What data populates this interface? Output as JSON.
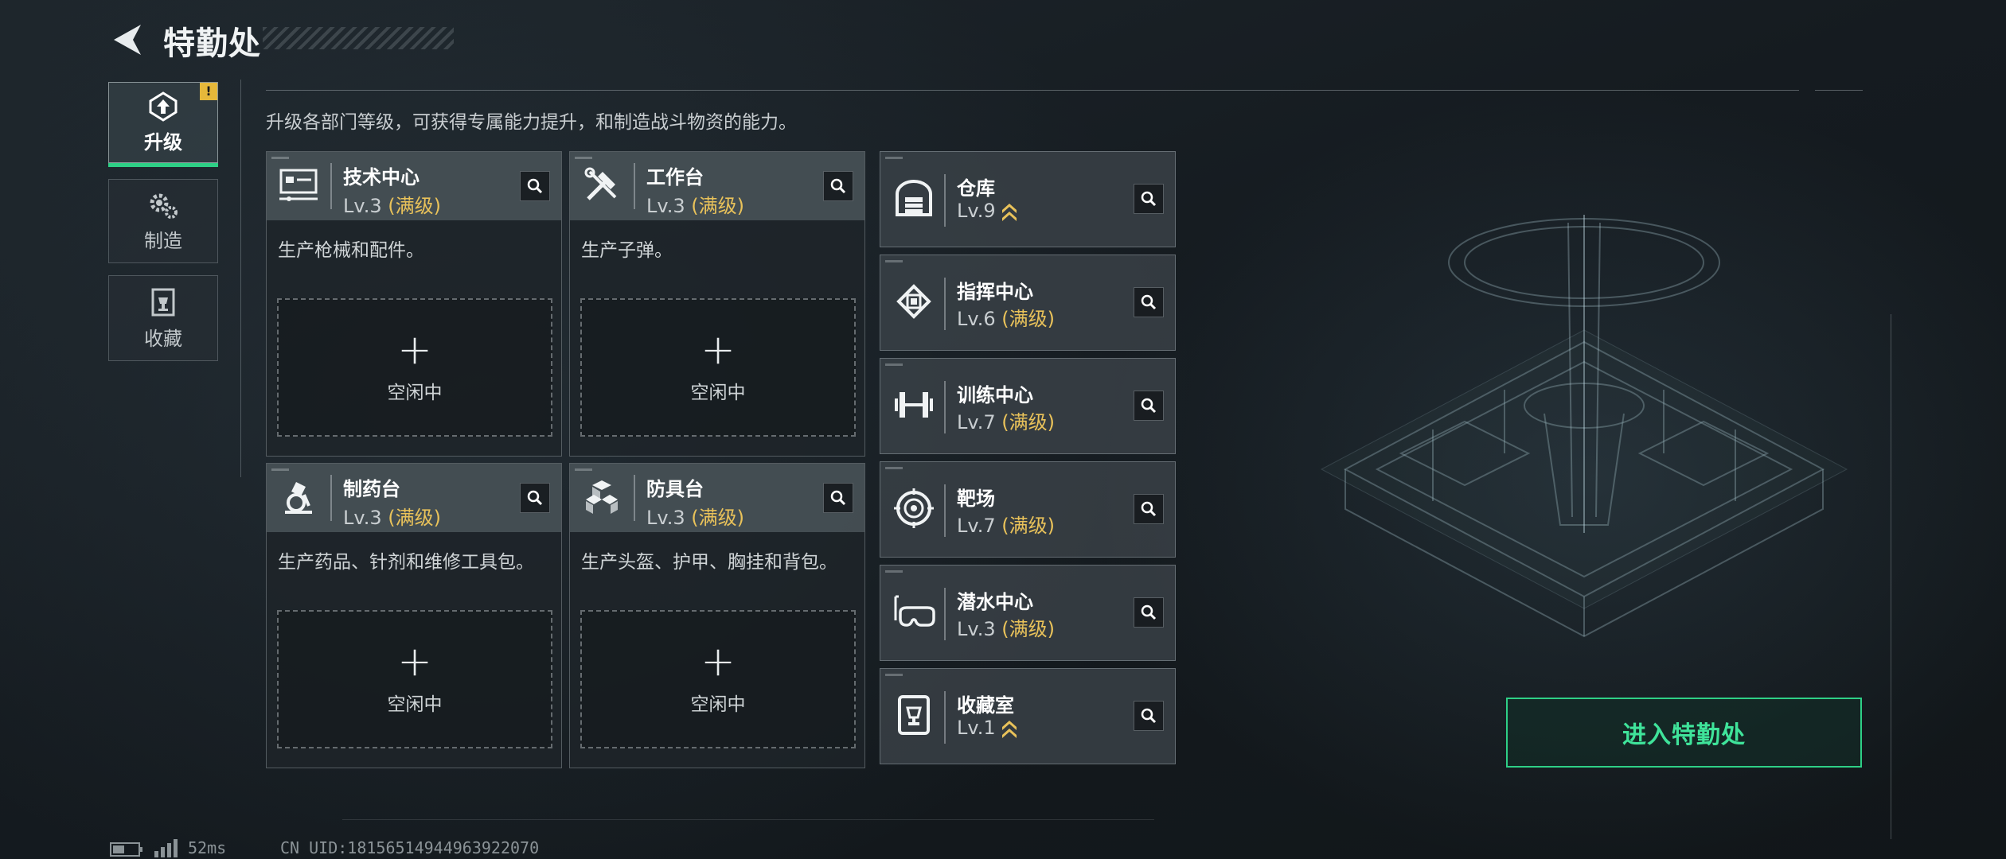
{
  "header": {
    "title": "特勤处"
  },
  "sidebar": {
    "items": [
      {
        "label": "升级",
        "icon": "upgrade-icon",
        "active": true,
        "badge": "!"
      },
      {
        "label": "制造",
        "icon": "gears-icon",
        "active": false
      },
      {
        "label": "收藏",
        "icon": "trophy-icon",
        "active": false
      }
    ]
  },
  "main": {
    "description": "升级各部门等级，可获得专属能力提升，和制造战斗物资的能力。",
    "workstations": [
      {
        "name": "技术中心",
        "level": "Lv.3",
        "status": "(满级)",
        "desc": "生产枪械和配件。",
        "slot_plus": "+",
        "slot_label": "空闲中",
        "icon": "tech-center-icon"
      },
      {
        "name": "工作台",
        "level": "Lv.3",
        "status": "(满级)",
        "desc": "生产子弹。",
        "slot_plus": "+",
        "slot_label": "空闲中",
        "icon": "workbench-icon"
      },
      {
        "name": "制药台",
        "level": "Lv.3",
        "status": "(满级)",
        "desc": "生产药品、针剂和维修工具包。",
        "slot_plus": "+",
        "slot_label": "空闲中",
        "icon": "microscope-icon"
      },
      {
        "name": "防具台",
        "level": "Lv.3",
        "status": "(满级)",
        "desc": "生产头盔、护甲、胸挂和背包。",
        "slot_plus": "+",
        "slot_label": "空闲中",
        "icon": "armor-icon"
      }
    ],
    "facilities": [
      {
        "name": "仓库",
        "level": "Lv.9",
        "status": "",
        "upgradable": true,
        "icon": "warehouse-icon"
      },
      {
        "name": "指挥中心",
        "level": "Lv.6",
        "status": "(满级)",
        "upgradable": false,
        "icon": "chip-icon"
      },
      {
        "name": "训练中心",
        "level": "Lv.7",
        "status": "(满级)",
        "upgradable": false,
        "icon": "dumbbell-icon"
      },
      {
        "name": "靶场",
        "level": "Lv.7",
        "status": "(满级)",
        "upgradable": false,
        "icon": "target-icon"
      },
      {
        "name": "潜水中心",
        "level": "Lv.3",
        "status": "(满级)",
        "upgradable": false,
        "icon": "diving-mask-icon"
      },
      {
        "name": "收藏室",
        "level": "Lv.1",
        "status": "",
        "upgradable": true,
        "icon": "trophy-icon"
      }
    ]
  },
  "enter_button": {
    "label": "进入特勤处"
  },
  "status_bar": {
    "ping": "52ms",
    "uid": "CN UID:18156514944963922070"
  },
  "colors": {
    "accent": "#2ecf86",
    "max_level": "#e9c25a",
    "warning": "#e6b83a"
  }
}
